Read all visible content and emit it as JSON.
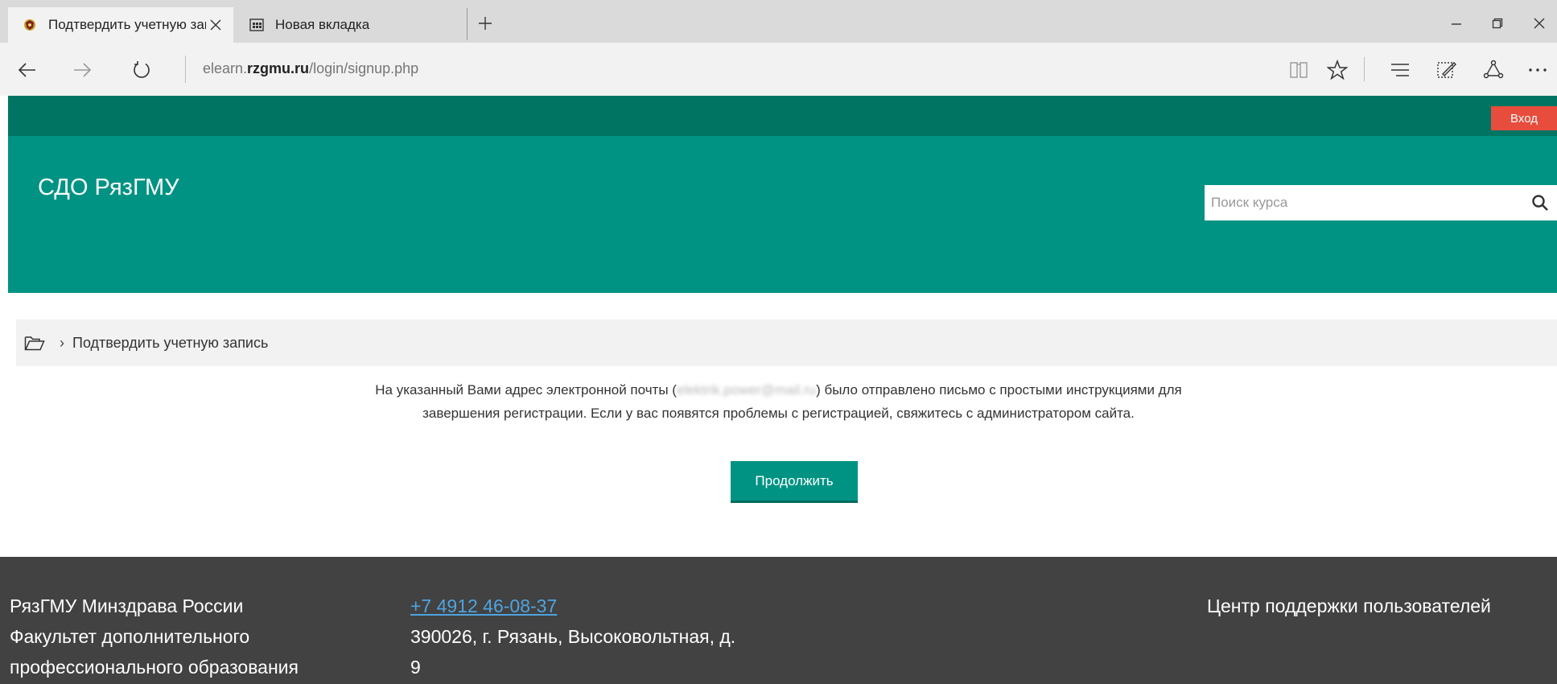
{
  "browser": {
    "tabs": [
      {
        "title": "Подтвердить учетную запись",
        "active": true
      },
      {
        "title": "Новая вкладка",
        "active": false
      }
    ],
    "address": {
      "prefix": "elearn.",
      "domain": "rzgmu.ru",
      "path": "/login/signup.php"
    }
  },
  "site": {
    "login_label": "Вход",
    "title": "СДО РязГМУ",
    "search_placeholder": "Поиск курса",
    "breadcrumb": {
      "separator": "›",
      "current": "Подтвердить учетную запись"
    },
    "message": {
      "part1": "На указанный Вами адрес электронной почты (",
      "email": "elektrik.power@mail.ru",
      "part2": ") было отправлено письмо с простыми инструкциями для",
      "line2": "завершения регистрации. Если у вас появятся проблемы с регистрацией, свяжитесь с администратором сайта."
    },
    "continue_label": "Продолжить"
  },
  "footer": {
    "org_line1": "РязГМУ Минздрава России",
    "org_line2": "Факультет дополнительного",
    "org_line3": "профессионального образования",
    "phone": "+7 4912 46-08-37",
    "address_line1": "390026, г. Рязань, Высоковольтная, д.",
    "address_line2": "9",
    "support": "Центр поддержки пользователей"
  },
  "colors": {
    "topbar": "#007463",
    "header": "#009383",
    "login": "#e74c3c",
    "footer": "#424242",
    "link": "#4fa3e0"
  }
}
